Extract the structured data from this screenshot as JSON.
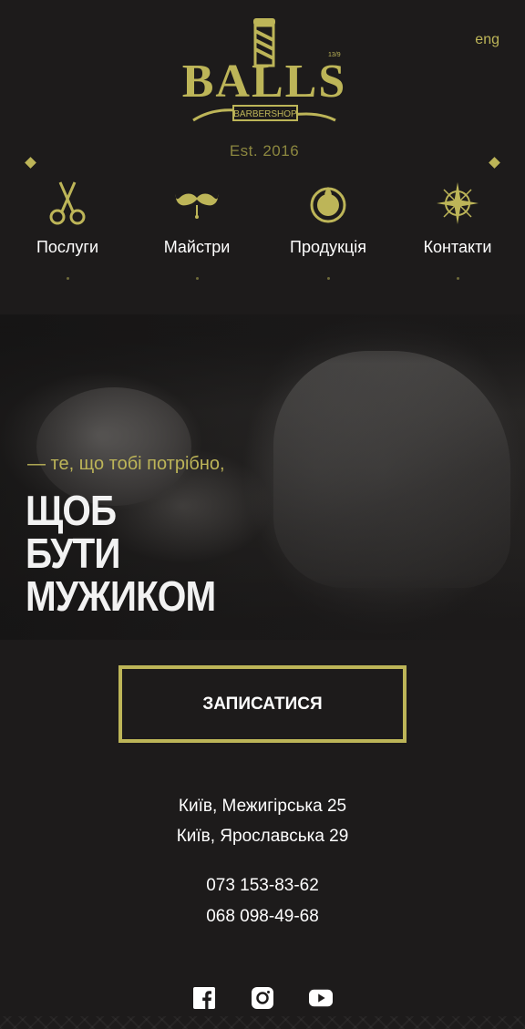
{
  "header": {
    "lang_label": "eng",
    "logo_text": "BALLS",
    "logo_subtext": "BARBERSHOP",
    "logo_badge": "13/9",
    "established": "Est. 2016"
  },
  "nav": {
    "items": [
      {
        "label": "Послуги",
        "icon": "scissors-icon"
      },
      {
        "label": "Майстри",
        "icon": "mustache-icon"
      },
      {
        "label": "Продукція",
        "icon": "product-jar-icon"
      },
      {
        "label": "Контакти",
        "icon": "compass-icon"
      }
    ]
  },
  "hero": {
    "tagline": "— те, що тобі потрібно,",
    "headline": [
      "ЩОБ",
      "БУТИ",
      "МУЖИКОМ"
    ]
  },
  "cta": {
    "label": "ЗАПИСАТИСЯ"
  },
  "contacts": {
    "addresses": [
      "Київ, Межигірська 25",
      "Київ, Ярославська 29"
    ],
    "phones": [
      "073 153-83-62",
      "068 098-49-68"
    ]
  },
  "social": {
    "icons": [
      "facebook-icon",
      "instagram-icon",
      "youtube-icon"
    ]
  },
  "colors": {
    "background": "#1d1b1b",
    "accent": "#bdb558",
    "text": "#ffffff"
  }
}
